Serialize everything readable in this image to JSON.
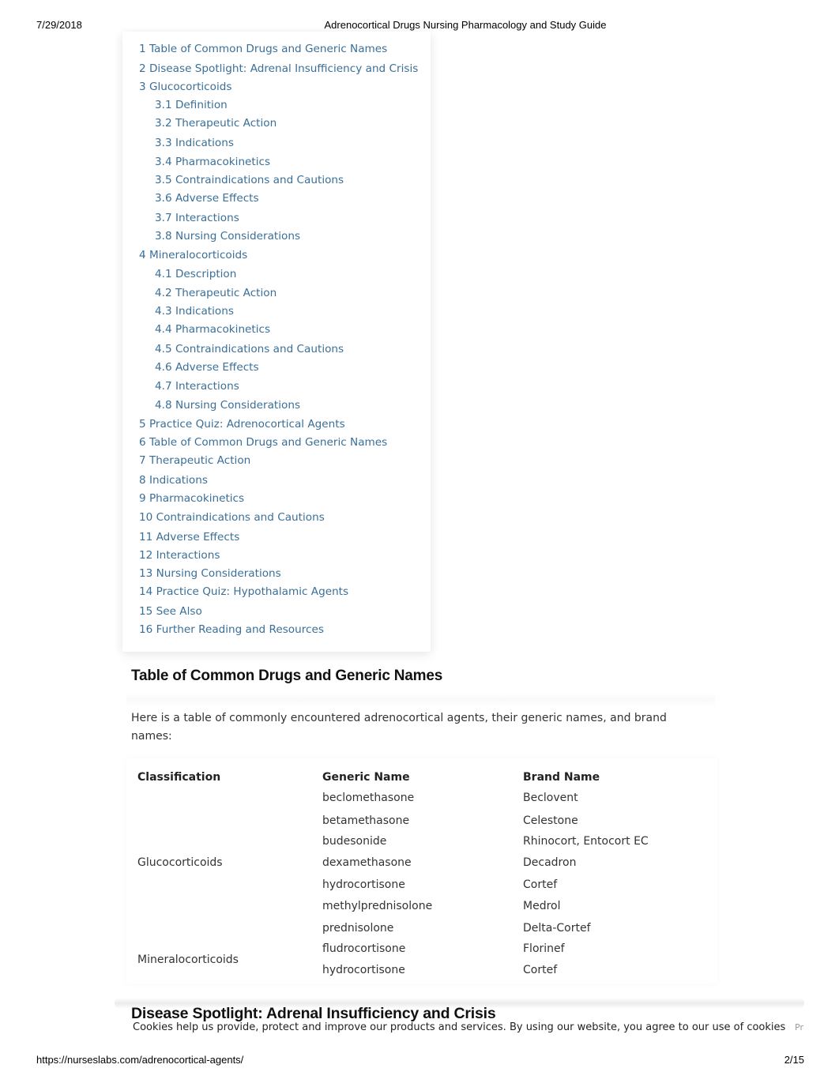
{
  "print_header": {
    "date": "7/29/2018",
    "title": "Adrenocortical Drugs Nursing Pharmacology and Study Guide"
  },
  "toc": {
    "items": [
      {
        "label": "1 Table of Common Drugs and Generic Names",
        "level": 1
      },
      {
        "label": "2 Disease Spotlight: Adrenal Insufficiency and Crisis",
        "level": 1
      },
      {
        "label": "3 Glucocorticoids",
        "level": 1
      },
      {
        "label": "3.1 Definition",
        "level": 2
      },
      {
        "label": "3.2 Therapeutic Action",
        "level": 2
      },
      {
        "label": "3.3 Indications",
        "level": 2
      },
      {
        "label": "3.4 Pharmacokinetics",
        "level": 2
      },
      {
        "label": "3.5 Contraindications and Cautions",
        "level": 2
      },
      {
        "label": "3.6 Adverse Effects",
        "level": 2
      },
      {
        "label": "3.7 Interactions",
        "level": 2
      },
      {
        "label": "3.8 Nursing Considerations",
        "level": 2
      },
      {
        "label": "4 Mineralocorticoids",
        "level": 1
      },
      {
        "label": "4.1 Description",
        "level": 2
      },
      {
        "label": "4.2 Therapeutic Action",
        "level": 2
      },
      {
        "label": "4.3 Indications",
        "level": 2
      },
      {
        "label": "4.4 Pharmacokinetics",
        "level": 2
      },
      {
        "label": "4.5 Contraindications and Cautions",
        "level": 2
      },
      {
        "label": "4.6 Adverse Effects",
        "level": 2
      },
      {
        "label": "4.7 Interactions",
        "level": 2
      },
      {
        "label": "4.8 Nursing Considerations",
        "level": 2
      },
      {
        "label": "5 Practice Quiz: Adrenocortical Agents",
        "level": 1
      },
      {
        "label": "6 Table of Common Drugs and Generic Names",
        "level": 1
      },
      {
        "label": "7 Therapeutic Action",
        "level": 1
      },
      {
        "label": "8 Indications",
        "level": 1
      },
      {
        "label": "9 Pharmacokinetics",
        "level": 1
      },
      {
        "label": "10 Contraindications and Cautions",
        "level": 1
      },
      {
        "label": "11 Adverse Effects",
        "level": 1
      },
      {
        "label": "12 Interactions",
        "level": 1
      },
      {
        "label": "13 Nursing Considerations",
        "level": 1
      },
      {
        "label": "14 Practice Quiz: Hypothalamic Agents",
        "level": 1
      },
      {
        "label": "15 See Also",
        "level": 1
      },
      {
        "label": "16 Further Reading and Resources",
        "level": 1
      }
    ]
  },
  "section_drugs": {
    "heading": "Table of Common Drugs and Generic Names",
    "intro": "Here is a table of commonly encountered adrenocortical agents, their generic names, and brand names:",
    "table": {
      "headers": {
        "classification": "Classification",
        "generic": "Generic Name",
        "brand": "Brand Name"
      },
      "groups": [
        {
          "classification": "Glucocorticoids",
          "rows": [
            {
              "generic": "beclomethasone",
              "brand": "Beclovent"
            },
            {
              "generic": "betamethasone",
              "brand": "Celestone"
            },
            {
              "generic": "budesonide",
              "brand": "Rhinocort, Entocort EC"
            },
            {
              "generic": "dexamethasone",
              "brand": "Decadron"
            },
            {
              "generic": "hydrocortisone",
              "brand": "Cortef"
            },
            {
              "generic": "methylprednisolone",
              "brand": "Medrol"
            },
            {
              "generic": "prednisolone",
              "brand": "Delta-Cortef"
            }
          ]
        },
        {
          "classification": "Mineralocorticoids",
          "rows": [
            {
              "generic": "fludrocortisone",
              "brand": "Florinef"
            },
            {
              "generic": "hydrocortisone",
              "brand": "Cortef"
            }
          ]
        }
      ]
    }
  },
  "section_disease": {
    "heading": "Disease Spotlight: Adrenal Insufficiency and Crisis"
  },
  "cookie_banner": {
    "text": "Cookies help us provide, protect and improve our products and services. By using our website, you agree to our use of cookies",
    "more_label": "Pr"
  },
  "print_footer": {
    "url": "https://nurseslabs.com/adrenocortical-agents/",
    "page": "2/15"
  }
}
